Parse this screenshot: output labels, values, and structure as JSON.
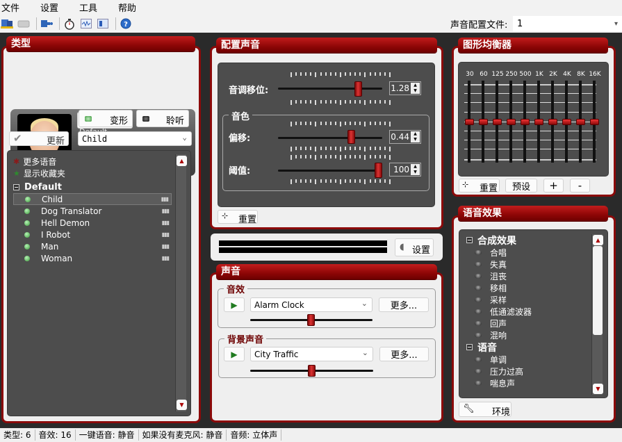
{
  "menu": [
    "文件",
    "设置",
    "工具",
    "帮助"
  ],
  "toolbar": {
    "icons": [
      "voice-library-icon",
      "keyboard-icon",
      "plugin-icon",
      "stopwatch-icon",
      "waveform-icon",
      "voice-editor-icon",
      "help-icon"
    ]
  },
  "profile": {
    "label": "声音配置文件:",
    "value": "1"
  },
  "voice_panel": {
    "title": "类型",
    "current_name": "Child",
    "current_group": "Default",
    "morph_label": "变形",
    "listen_label": "聆听",
    "update_label": "更新",
    "voice_select": "Child",
    "more_voices": "更多语音",
    "show_favorites": "显示收藏夹",
    "group": "Default",
    "voices": [
      "Child",
      "Dog Translator",
      "Hell Demon",
      "I Robot",
      "Man",
      "Woman"
    ],
    "selected_voice": "Child"
  },
  "config_panel": {
    "title": "配置声音",
    "pitch_label": "音调移位:",
    "pitch_value": "1.28",
    "pitch_fraction": 0.79,
    "timbre_group": "音色",
    "offset_label": "偏移:",
    "offset_value": "0.44",
    "offset_fraction": 0.72,
    "threshold_label": "阈值:",
    "threshold_value": "100",
    "threshold_fraction": 1.0,
    "reset_label": "重置"
  },
  "level": {
    "settings_label": "设置"
  },
  "sound_panel": {
    "title": "声音",
    "effects_group": "音效",
    "effect_select": "Alarm Clock",
    "effect_more": "更多...",
    "effect_volume_fraction": 0.5,
    "bg_group": "背景声音",
    "bg_select": "City Traffic",
    "bg_more": "更多...",
    "bg_volume_fraction": 0.5
  },
  "eq_panel": {
    "title": "图形均衡器",
    "bands": [
      "30",
      "60",
      "125",
      "250",
      "500",
      "1K",
      "2K",
      "4K",
      "8K",
      "16K"
    ],
    "band_levels": [
      0,
      0,
      0,
      0,
      0,
      0,
      0,
      0,
      0,
      0
    ],
    "reset_label": "重置",
    "preset_label": "预设",
    "plus_label": "+",
    "minus_label": "-"
  },
  "fx_panel": {
    "title": "语音效果",
    "groups": [
      {
        "name": "合成效果",
        "items": [
          "合唱",
          "失真",
          "沮丧",
          "移相",
          "采样",
          "低通滤波器",
          "回声",
          "混响"
        ]
      },
      {
        "name": "语音",
        "items": [
          "单调",
          "压力过高",
          "喘息声"
        ]
      }
    ],
    "env_label": "环境"
  },
  "status": [
    "类型: 6",
    "音效: 16",
    "一键语音: 静音",
    "如果没有麦克风: 静音",
    "音频: 立体声"
  ]
}
